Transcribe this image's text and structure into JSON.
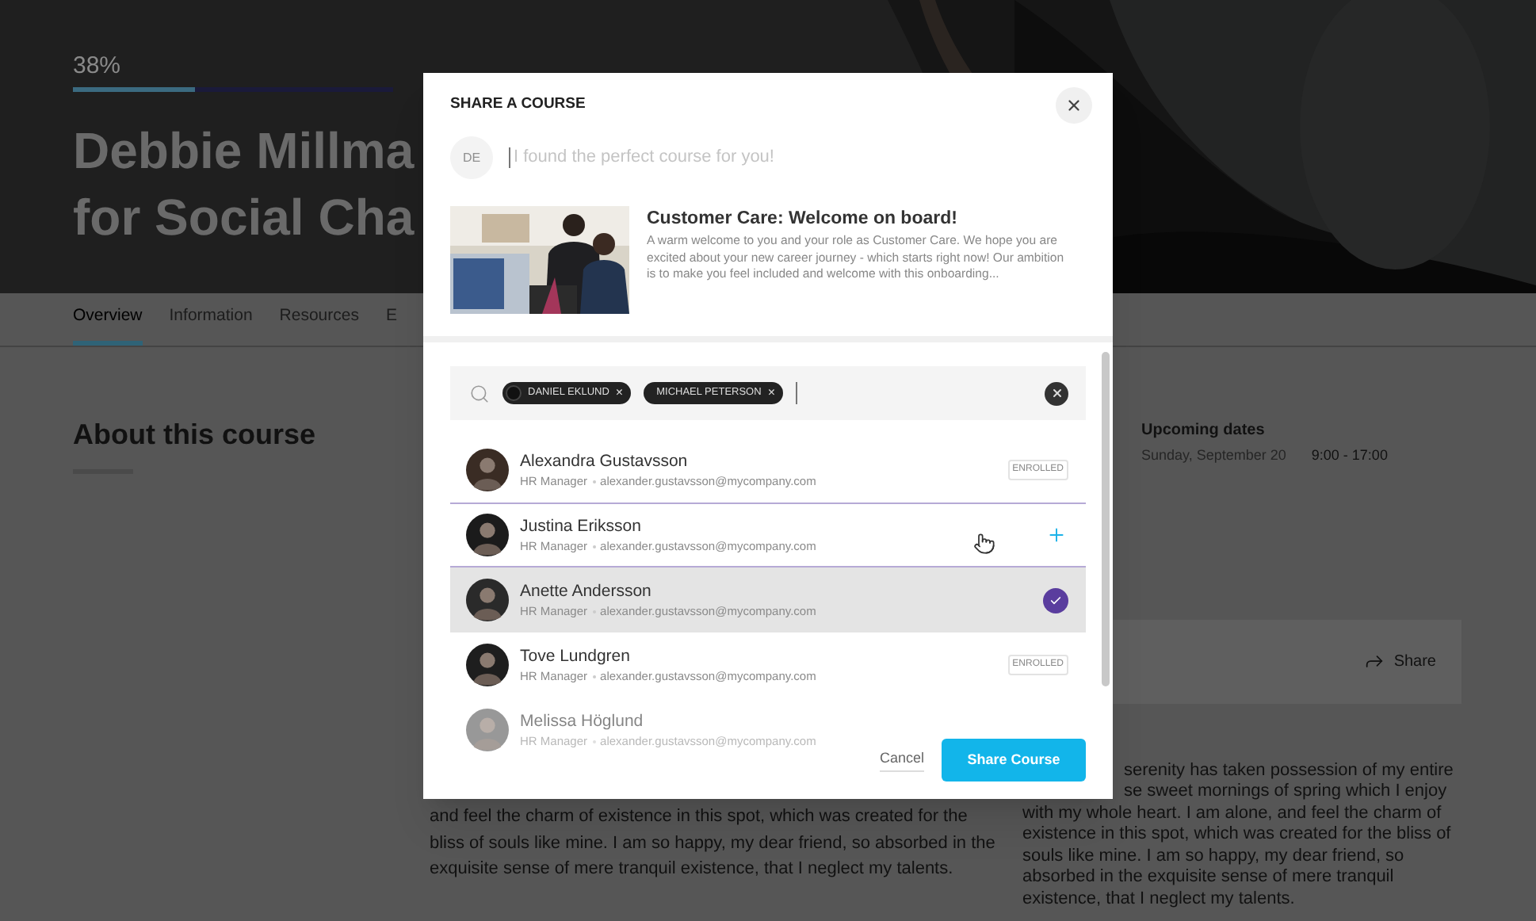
{
  "hero": {
    "progress_text": "38%",
    "level": 0.38,
    "title_lines": [
      "Debbie Millma",
      "for Social Cha"
    ]
  },
  "tabs": [
    {
      "label": "Overview",
      "selected": true
    },
    {
      "label": "Information",
      "selected": false
    },
    {
      "label": "Resources",
      "selected": false
    },
    {
      "label": "E",
      "selected": false
    }
  ],
  "about": {
    "heading": "About this course"
  },
  "upcoming": {
    "heading": "Upcoming dates",
    "date": "Sunday, September 20",
    "time": "9:00 - 17:00"
  },
  "share_card": {
    "label": "Share"
  },
  "description_left": [
    "and feel the charm of existence in this spot, which was created for the",
    "bliss of souls like mine. I am so happy, my dear friend, so absorbed in the",
    "exquisite sense of mere tranquil existence, that I neglect my talents."
  ],
  "description_right": [
    "serenity has taken possession of my entire",
    "se sweet mornings of spring which I enjoy",
    "with my whole heart. I am alone, and feel the charm of",
    "existence in this spot, which was created for the bliss of",
    "souls like mine. I am so happy, my dear friend, so",
    "absorbed in the exquisite sense of mere tranquil",
    "existence, that I neglect my talents."
  ],
  "modal": {
    "title": "SHARE A COURSE",
    "sender_initials": "DE",
    "message_placeholder": "I found the perfect course for you!",
    "course": {
      "title": "Customer Care: Welcome on board!",
      "description": "A warm welcome to you and your role as Customer Care. We hope you are excited about your new career journey - which starts right now! Our ambition is to make you feel included and welcome with this onboarding..."
    },
    "tags": [
      {
        "label": "DANIEL EKLUND",
        "remove": "×",
        "has_photo": true
      },
      {
        "label": "MICHAEL PETERSON",
        "remove": "×",
        "has_photo": false
      }
    ],
    "people": [
      {
        "name": "Alexandra Gustavsson",
        "role": "HR Manager",
        "email": "alexander.gustavsson@mycompany.com",
        "kind": "enrolled",
        "badge": "ENROLLED",
        "hovered": false,
        "selected": false
      },
      {
        "name": "Justina Eriksson",
        "role": "HR Manager",
        "email": "alexander.gustavsson@mycompany.com",
        "kind": "add",
        "hovered": true,
        "selected": false
      },
      {
        "name": "Anette Andersson",
        "role": "HR Manager",
        "email": "alexander.gustavsson@mycompany.com",
        "kind": "check",
        "hovered": false,
        "selected": true
      },
      {
        "name": "Tove Lundgren",
        "role": "HR Manager",
        "email": "alexander.gustavsson@mycompany.com",
        "kind": "enrolled",
        "badge": "ENROLLED",
        "hovered": false,
        "selected": false
      },
      {
        "name": "Melissa Höglund",
        "role": "HR Manager",
        "email": "alexander.gustavsson@mycompany.com",
        "kind": "none",
        "hovered": false,
        "selected": false
      }
    ],
    "cancel": "Cancel",
    "submit": "Share Course"
  }
}
